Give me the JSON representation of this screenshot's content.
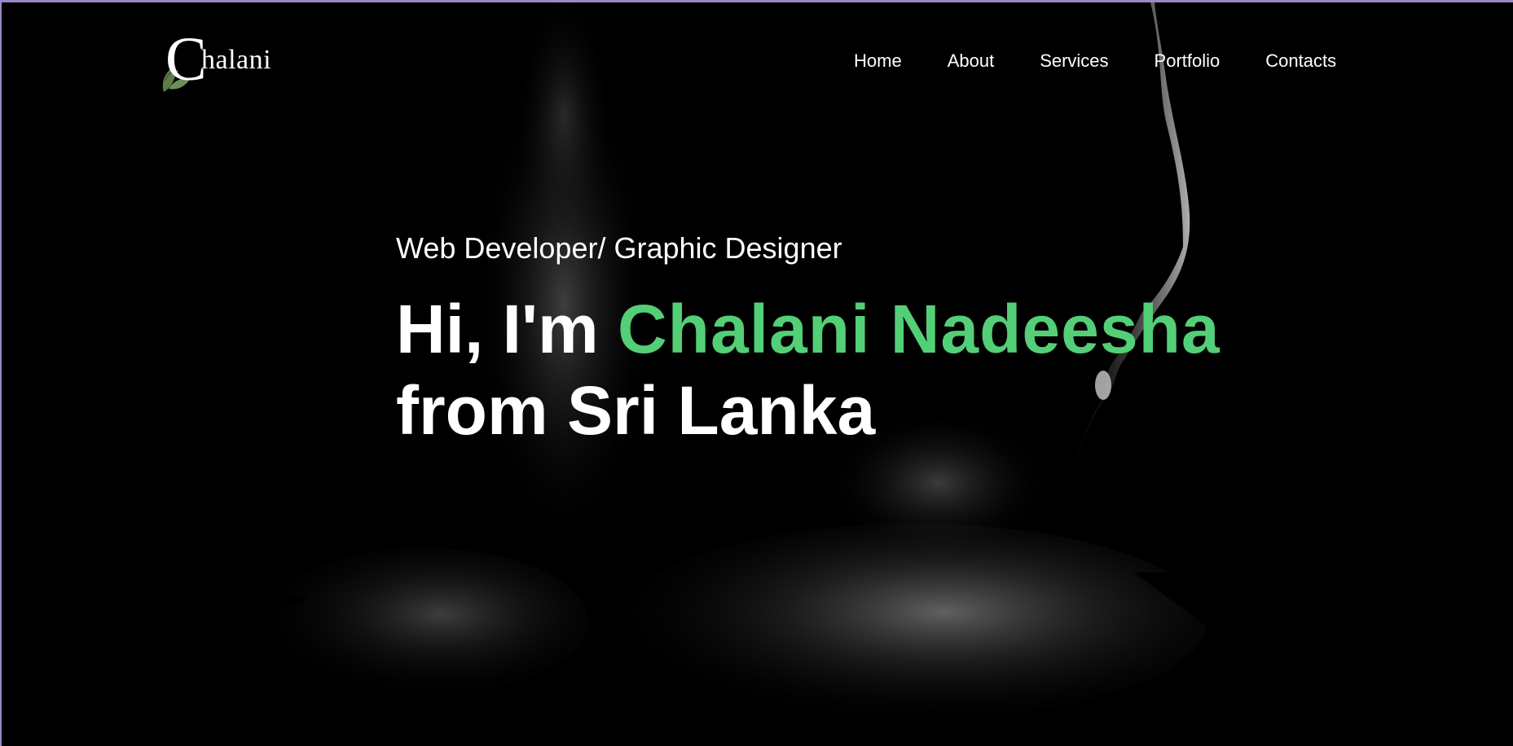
{
  "brand": {
    "logo_initial": "C",
    "logo_rest": "halani"
  },
  "nav": {
    "items": [
      "Home",
      "About",
      "Services",
      "Portfolio",
      "Contacts"
    ]
  },
  "hero": {
    "subtitle": "Web Developer/ Graphic Designer",
    "greeting": "Hi, I'm ",
    "name": "Chalani Nadeesha",
    "line2": "from Sri Lanka"
  },
  "colors": {
    "accent": "#53cf77",
    "background": "#000000",
    "frame": "#9b87c4",
    "text": "#ffffff",
    "leaf": "#5e7d4a"
  },
  "icons": {
    "logo_leaf": "leaf-icon"
  }
}
